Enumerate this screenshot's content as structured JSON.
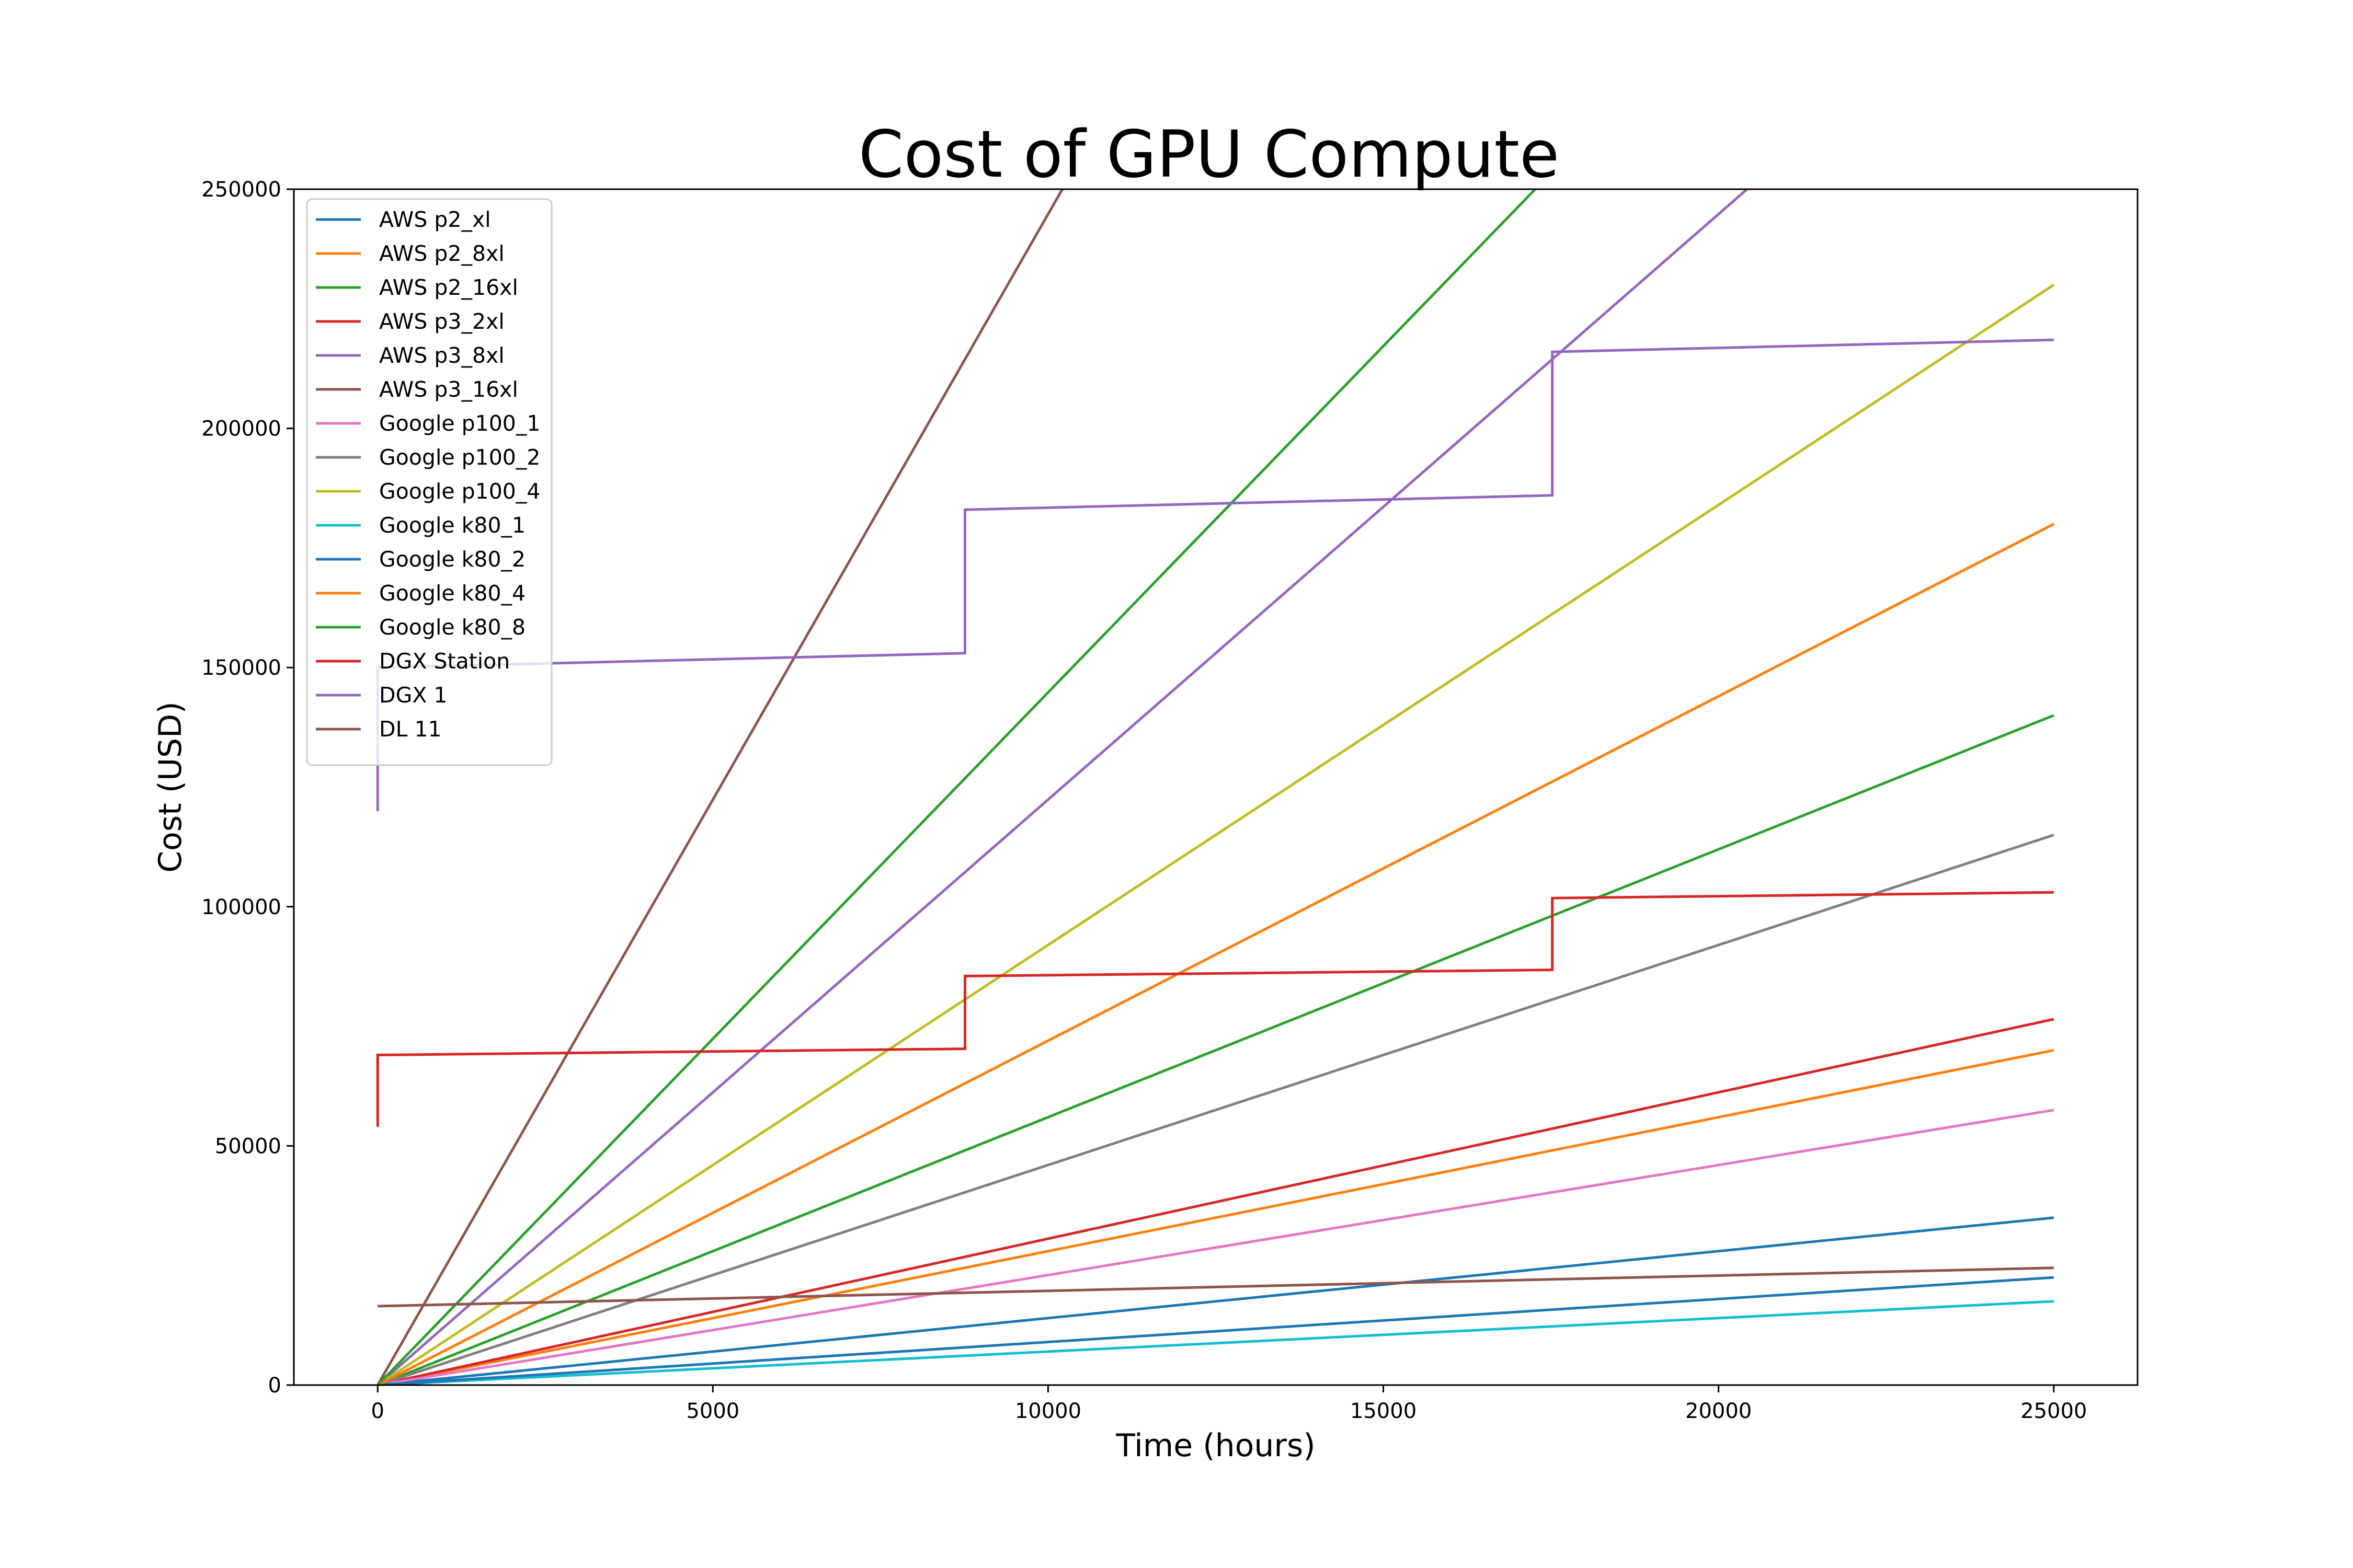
{
  "chart_data": {
    "type": "line",
    "title": "Cost of GPU Compute",
    "xlabel": "Time (hours)",
    "ylabel": "Cost (USD)",
    "xlim": [
      -1250,
      26250
    ],
    "ylim": [
      0,
      250000
    ],
    "xticks": [
      0,
      5000,
      10000,
      15000,
      20000,
      25000
    ],
    "yticks": [
      0,
      50000,
      100000,
      150000,
      200000,
      250000
    ],
    "grid": false,
    "legend_position": "upper-left",
    "series": [
      {
        "name": "AWS p2_xl",
        "color": "#1f77b4",
        "points": [
          [
            0,
            0
          ],
          [
            25000,
            35000
          ]
        ]
      },
      {
        "name": "AWS p2_8xl",
        "color": "#ff7f0e",
        "points": [
          [
            0,
            0
          ],
          [
            25000,
            70000
          ]
        ]
      },
      {
        "name": "AWS p2_16xl",
        "color": "#2ca02c",
        "points": [
          [
            0,
            0
          ],
          [
            25000,
            140000
          ]
        ]
      },
      {
        "name": "AWS p3_2xl",
        "color": "#d62728",
        "points": [
          [
            0,
            0
          ],
          [
            25000,
            76500
          ]
        ]
      },
      {
        "name": "AWS p3_8xl",
        "color": "#9467bd",
        "points": [
          [
            0,
            0
          ],
          [
            25000,
            306000
          ]
        ]
      },
      {
        "name": "AWS p3_16xl",
        "color": "#8c564b",
        "points": [
          [
            0,
            0
          ],
          [
            25000,
            612000
          ]
        ]
      },
      {
        "name": "Google p100_1",
        "color": "#e377c2",
        "points": [
          [
            0,
            0
          ],
          [
            25000,
            57500
          ]
        ]
      },
      {
        "name": "Google p100_2",
        "color": "#7f7f7f",
        "points": [
          [
            0,
            0
          ],
          [
            25000,
            115000
          ]
        ]
      },
      {
        "name": "Google p100_4",
        "color": "#bcbd22",
        "points": [
          [
            0,
            0
          ],
          [
            25000,
            230000
          ]
        ]
      },
      {
        "name": "Google k80_1",
        "color": "#17becf",
        "points": [
          [
            0,
            0
          ],
          [
            25000,
            17500
          ]
        ]
      },
      {
        "name": "Google k80_2",
        "color": "#1f77b4",
        "points": [
          [
            0,
            0
          ],
          [
            25000,
            22500
          ]
        ]
      },
      {
        "name": "Google k80_4",
        "color": "#ff7f0e",
        "points": [
          [
            0,
            0
          ],
          [
            25000,
            180000
          ]
        ]
      },
      {
        "name": "Google k80_8",
        "color": "#2ca02c",
        "points": [
          [
            0,
            0
          ],
          [
            25000,
            362000
          ]
        ]
      },
      {
        "name": " DGX Station",
        "color": "#d62728",
        "points": [
          [
            0,
            54000
          ],
          [
            0,
            69000
          ],
          [
            8760,
            70300
          ],
          [
            8760,
            85500
          ],
          [
            17520,
            86800
          ],
          [
            17520,
            101800
          ],
          [
            25000,
            103000
          ]
        ]
      },
      {
        "name": "DGX 1",
        "color": "#9467bd",
        "points": [
          [
            0,
            120000
          ],
          [
            0,
            150000
          ],
          [
            8760,
            153000
          ],
          [
            8760,
            183000
          ],
          [
            17520,
            186000
          ],
          [
            17520,
            216000
          ],
          [
            25000,
            218500
          ]
        ]
      },
      {
        "name": "DL 11",
        "color": "#8c564b",
        "points": [
          [
            0,
            16500
          ],
          [
            25000,
            24500
          ]
        ]
      }
    ]
  }
}
